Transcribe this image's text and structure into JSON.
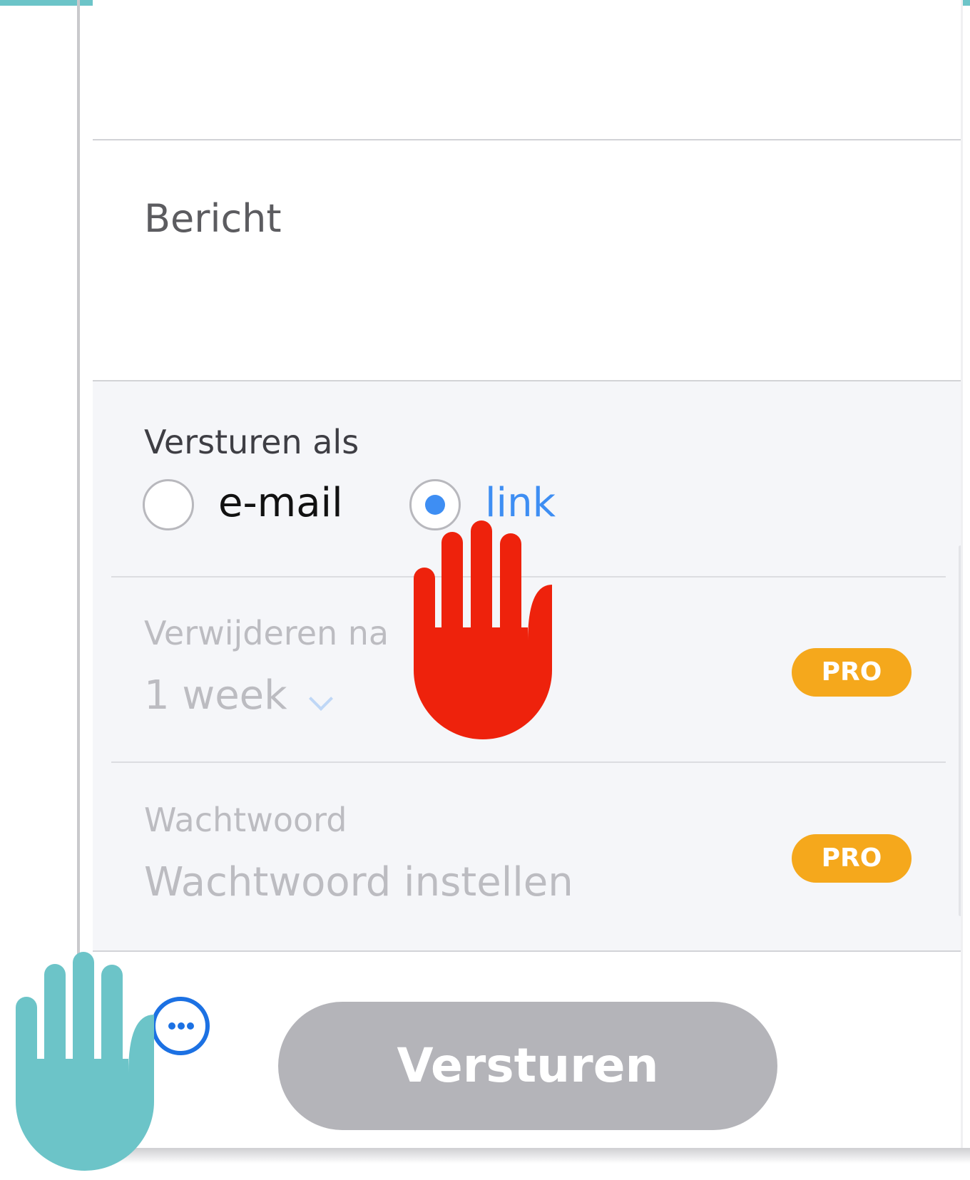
{
  "form": {
    "message_placeholder": "Bericht",
    "send_as": {
      "label": "Versturen als",
      "options": [
        {
          "label": "e-mail",
          "selected": false
        },
        {
          "label": "link",
          "selected": true
        }
      ]
    },
    "delete_after": {
      "label": "Verwijderen na",
      "value": "1 week",
      "badge": "PRO"
    },
    "password": {
      "label": "Wachtwoord",
      "placeholder": "Wachtwoord instellen",
      "badge": "PRO"
    }
  },
  "footer": {
    "more_icon": "more-horizontal-icon",
    "send_label": "Versturen"
  },
  "overlays": {
    "center_hand": "stop-hand-icon",
    "corner_hand": "stop-hand-icon"
  },
  "colors": {
    "accent_blue": "#3e8ef3",
    "pro_badge": "#f5a81c",
    "stop_hand_red": "#ee220c",
    "teal": "#6cc4c8",
    "disabled_button": "#b4b4b9"
  }
}
